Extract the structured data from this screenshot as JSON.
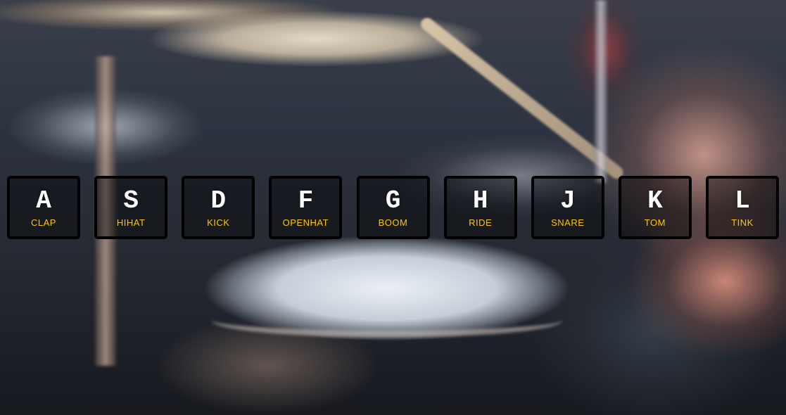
{
  "colors": {
    "key_letter": "#ffffff",
    "sound_label": "#ffc600",
    "key_border": "#000000"
  },
  "keys": [
    {
      "letter": "A",
      "sound": "CLAP"
    },
    {
      "letter": "S",
      "sound": "HIHAT"
    },
    {
      "letter": "D",
      "sound": "KICK"
    },
    {
      "letter": "F",
      "sound": "OPENHAT"
    },
    {
      "letter": "G",
      "sound": "BOOM"
    },
    {
      "letter": "H",
      "sound": "RIDE"
    },
    {
      "letter": "J",
      "sound": "SNARE"
    },
    {
      "letter": "K",
      "sound": "TOM"
    },
    {
      "letter": "L",
      "sound": "TINK"
    }
  ]
}
